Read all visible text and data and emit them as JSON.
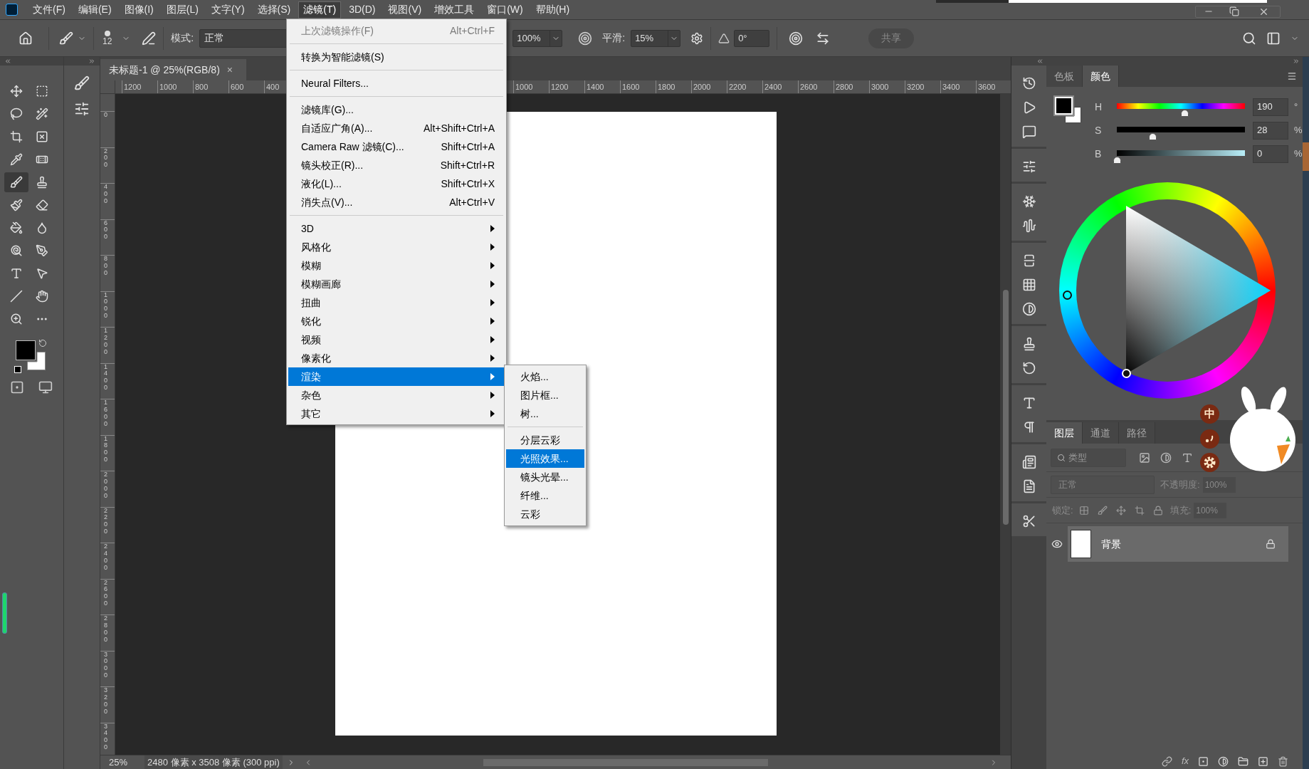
{
  "menu_bar": {
    "items": [
      {
        "label": "文件(F)",
        "selected": false
      },
      {
        "label": "编辑(E)",
        "selected": false
      },
      {
        "label": "图像(I)",
        "selected": false
      },
      {
        "label": "图层(L)",
        "selected": false
      },
      {
        "label": "文字(Y)",
        "selected": false
      },
      {
        "label": "选择(S)",
        "selected": false
      },
      {
        "label": "滤镜(T)",
        "selected": true
      },
      {
        "label": "3D(D)",
        "selected": false
      },
      {
        "label": "视图(V)",
        "selected": false
      },
      {
        "label": "增效工具",
        "selected": false
      },
      {
        "label": "窗口(W)",
        "selected": false
      },
      {
        "label": "帮助(H)",
        "selected": false
      }
    ]
  },
  "options_bar": {
    "brush_size": "12",
    "mode_label": "模式:",
    "mode_value": "正常",
    "opacity_value": "100%",
    "smoothing_label": "平滑:",
    "smoothing_value": "15%",
    "angle_value": "0°",
    "share_button": {
      "label": "共享",
      "disabled": true
    }
  },
  "tools": [
    {
      "kind": "move",
      "selected": false
    },
    {
      "kind": "marquee",
      "selected": false
    },
    {
      "kind": "lasso",
      "selected": false
    },
    {
      "kind": "wand",
      "selected": false
    },
    {
      "kind": "crop",
      "selected": false
    },
    {
      "kind": "frame",
      "selected": false
    },
    {
      "kind": "eyedropper",
      "selected": false
    },
    {
      "kind": "healing",
      "selected": false
    },
    {
      "kind": "brush",
      "selected": true
    },
    {
      "kind": "stamp",
      "selected": false
    },
    {
      "kind": "history",
      "selected": false
    },
    {
      "kind": "eraser",
      "selected": false
    },
    {
      "kind": "bucket",
      "selected": false
    },
    {
      "kind": "blur",
      "selected": false
    },
    {
      "kind": "dodge",
      "selected": false
    },
    {
      "kind": "pen",
      "selected": false
    },
    {
      "kind": "type",
      "selected": false
    },
    {
      "kind": "select",
      "selected": false
    },
    {
      "kind": "line",
      "selected": false
    },
    {
      "kind": "hand",
      "selected": false
    },
    {
      "kind": "zoom",
      "selected": false
    },
    {
      "kind": "more",
      "selected": false
    }
  ],
  "document_tab": {
    "title": "未标题-1 @ 25%(RGB/8)",
    "close": "×"
  },
  "ruler": {
    "left_labels": [
      "1200",
      "1000",
      "800",
      "600",
      "400"
    ],
    "right_labels": [
      "1000",
      "1200",
      "1400",
      "1600",
      "1800",
      "2000",
      "2200",
      "2400",
      "2600",
      "2800",
      "3000",
      "3200",
      "3400",
      "3600"
    ],
    "vertical_labels": [
      "0",
      "200",
      "400",
      "600",
      "800",
      "1000",
      "1200",
      "1400",
      "1600",
      "1800",
      "2000",
      "2200",
      "2400",
      "2600",
      "2800",
      "3000",
      "3200",
      "3400"
    ]
  },
  "filter_menu": {
    "groups": [
      [
        {
          "label": "上次滤镜操作(F)",
          "shortcut": "Alt+Ctrl+F",
          "has_submenu": false,
          "disabled": true,
          "selected": false
        }
      ],
      [
        {
          "label": "转换为智能滤镜(S)",
          "has_submenu": false,
          "disabled": false,
          "selected": false
        }
      ],
      [
        {
          "label": "Neural Filters...",
          "has_submenu": false,
          "disabled": false,
          "selected": false
        }
      ],
      [
        {
          "label": "滤镜库(G)...",
          "has_submenu": false,
          "disabled": false,
          "selected": false
        },
        {
          "label": "自适应广角(A)...",
          "shortcut": "Alt+Shift+Ctrl+A",
          "has_submenu": false,
          "disabled": false,
          "selected": false
        },
        {
          "label": "Camera Raw 滤镜(C)...",
          "shortcut": "Shift+Ctrl+A",
          "has_submenu": false,
          "disabled": false,
          "selected": false
        },
        {
          "label": "镜头校正(R)...",
          "shortcut": "Shift+Ctrl+R",
          "has_submenu": false,
          "disabled": false,
          "selected": false
        },
        {
          "label": "液化(L)...",
          "shortcut": "Shift+Ctrl+X",
          "has_submenu": false,
          "disabled": false,
          "selected": false
        },
        {
          "label": "消失点(V)...",
          "shortcut": "Alt+Ctrl+V",
          "has_submenu": false,
          "disabled": false,
          "selected": false
        }
      ],
      [
        {
          "label": "3D",
          "has_submenu": true,
          "disabled": false,
          "selected": false
        },
        {
          "label": "风格化",
          "has_submenu": true,
          "disabled": false,
          "selected": false
        },
        {
          "label": "模糊",
          "has_submenu": true,
          "disabled": false,
          "selected": false
        },
        {
          "label": "模糊画廊",
          "has_submenu": true,
          "disabled": false,
          "selected": false
        },
        {
          "label": "扭曲",
          "has_submenu": true,
          "disabled": false,
          "selected": false
        },
        {
          "label": "锐化",
          "has_submenu": true,
          "disabled": false,
          "selected": false
        },
        {
          "label": "视频",
          "has_submenu": true,
          "disabled": false,
          "selected": false
        },
        {
          "label": "像素化",
          "has_submenu": true,
          "disabled": false,
          "selected": false
        },
        {
          "label": "渲染",
          "has_submenu": true,
          "disabled": false,
          "selected": true
        },
        {
          "label": "杂色",
          "has_submenu": true,
          "disabled": false,
          "selected": false
        },
        {
          "label": "其它",
          "has_submenu": true,
          "disabled": false,
          "selected": false
        }
      ]
    ]
  },
  "render_submenu": {
    "groups": [
      [
        {
          "label": "火焰...",
          "selected": false
        },
        {
          "label": "图片框...",
          "selected": false
        },
        {
          "label": "树...",
          "selected": false
        }
      ],
      [
        {
          "label": "分层云彩",
          "selected": false
        },
        {
          "label": "光照效果...",
          "selected": true
        },
        {
          "label": "镜头光晕...",
          "selected": false
        },
        {
          "label": "纤维...",
          "selected": false
        },
        {
          "label": "云彩",
          "selected": false
        }
      ]
    ]
  },
  "status_bar": {
    "zoom": "25%",
    "info": "2480 像素 x 3508 像素 (300 ppi)"
  },
  "color_panel": {
    "tabs": [
      {
        "label": "色板",
        "selected": false
      },
      {
        "label": "颜色",
        "selected": true
      }
    ],
    "channels": [
      {
        "kind": "hue",
        "label": "H",
        "level": 0.528,
        "value": "190",
        "unit": "°"
      },
      {
        "kind": "saturation",
        "label": "S",
        "level": 0.28,
        "value": "28",
        "unit": "%"
      },
      {
        "kind": "brightness",
        "label": "B",
        "level": 0,
        "value": "0",
        "unit": "%"
      }
    ]
  },
  "layers_panel": {
    "tabs": [
      {
        "label": "图层",
        "selected": true
      },
      {
        "label": "通道",
        "selected": false
      },
      {
        "label": "路径",
        "selected": false
      }
    ],
    "filter_placeholder": "类型",
    "disabled": true,
    "blend_mode": "正常",
    "opacity_label": "不透明度:",
    "opacity_value": "100%",
    "lock_label": "锁定:",
    "fill_label": "填充:",
    "fill_value": "100%",
    "layers": [
      {
        "name": "背景",
        "visible": true,
        "locked": true,
        "selected": true
      }
    ],
    "footer_fx": "fx"
  },
  "ime_toolbar": {
    "mode": "中"
  }
}
